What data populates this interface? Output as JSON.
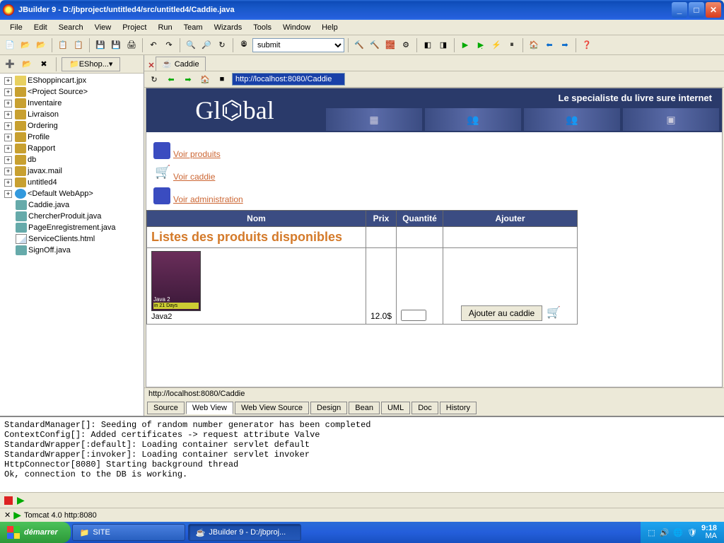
{
  "window": {
    "title": "JBuilder 9 - D:/jbproject/untitled4/src/untitled4/Caddie.java"
  },
  "menu": [
    "File",
    "Edit",
    "Search",
    "View",
    "Project",
    "Run",
    "Team",
    "Wizards",
    "Tools",
    "Window",
    "Help"
  ],
  "toolbar": {
    "combo_value": "submit"
  },
  "sidebar": {
    "tab": "EShop...",
    "items": [
      {
        "exp": "+",
        "icon": "root",
        "label": "EShoppincart.jpx"
      },
      {
        "exp": "+",
        "icon": "pkg",
        "label": "<Project Source>"
      },
      {
        "exp": "+",
        "icon": "pkg",
        "label": "Inventaire"
      },
      {
        "exp": "+",
        "icon": "pkg",
        "label": "Livraison"
      },
      {
        "exp": "+",
        "icon": "pkg",
        "label": "Ordering"
      },
      {
        "exp": "+",
        "icon": "pkg",
        "label": "Profile"
      },
      {
        "exp": "+",
        "icon": "pkg",
        "label": "Rapport"
      },
      {
        "exp": "+",
        "icon": "pkg",
        "label": "db"
      },
      {
        "exp": "+",
        "icon": "pkg",
        "label": "javax.mail"
      },
      {
        "exp": "+",
        "icon": "pkg",
        "label": "untitled4"
      },
      {
        "exp": "+",
        "icon": "web",
        "label": "<Default WebApp>"
      },
      {
        "exp": "",
        "icon": "java",
        "label": "Caddie.java"
      },
      {
        "exp": "",
        "icon": "java",
        "label": "ChercherProduit.java"
      },
      {
        "exp": "",
        "icon": "java",
        "label": "PageEnregistrement.java"
      },
      {
        "exp": "",
        "icon": "file",
        "label": "ServiceClients.html"
      },
      {
        "exp": "",
        "icon": "java",
        "label": "SignOff.java"
      }
    ]
  },
  "editor": {
    "tab_label": "Caddie",
    "url": "http://localhost:8080/Caddie",
    "status_url": "http://localhost:8080/Caddie"
  },
  "web": {
    "logo": "Gl⌬bal",
    "tagline": "Le specialiste du livre sure internet",
    "links": [
      {
        "label": "Voir produits",
        "icon": "cube"
      },
      {
        "label": "Voir caddie",
        "icon": "cart"
      },
      {
        "label": "Voir administration",
        "icon": "admin"
      }
    ],
    "table": {
      "headers": [
        "Nom",
        "Prix",
        "Quantité",
        "Ajouter"
      ],
      "section_title": "Listes des produits disponibles",
      "rows": [
        {
          "name": "Java2",
          "book_sub": "Java 2",
          "book_tag": "in 21 Days",
          "price": "12.0$",
          "qty": "",
          "add_btn": "Ajouter au caddie"
        }
      ]
    }
  },
  "viewtabs": [
    "Source",
    "Web View",
    "Web View Source",
    "Design",
    "Bean",
    "UML",
    "Doc",
    "History"
  ],
  "active_viewtab": 1,
  "console": {
    "lines": [
      "StandardManager[]: Seeding of random number generator has been completed",
      "ContextConfig[]: Added certificates -> request attribute Valve",
      "StandardWrapper[:default]: Loading container servlet default",
      "StandardWrapper[:invoker]: Loading container servlet invoker",
      "HttpConnector[8080] Starting background thread",
      "Ok, connection to the DB is working."
    ],
    "tab": "Tomcat 4.0 http:8080"
  },
  "taskbar": {
    "start": "démarrer",
    "buttons": [
      {
        "label": "SITE",
        "active": false
      },
      {
        "label": "JBuilder 9 - D:/jbproj...",
        "active": true
      }
    ],
    "clock_time": "9:18",
    "clock_ampm": "MA"
  }
}
